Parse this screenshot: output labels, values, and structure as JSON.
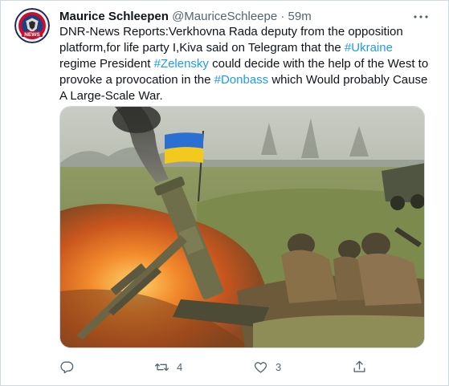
{
  "author": {
    "name": "Maurice Schleepen",
    "handle": "@MauriceSchleepe",
    "separator": "·",
    "time": "59m",
    "avatar_text": "NEWS"
  },
  "tweet": {
    "segments": [
      {
        "text": "DNR-News Reports:Verkhovna Rada deputy from the opposition platform,for life party I,Kiva said on Telegram that the ",
        "type": "text"
      },
      {
        "text": "#Ukraine",
        "type": "hashtag"
      },
      {
        "text": " regime President ",
        "type": "text"
      },
      {
        "text": "#Zelensky",
        "type": "hashtag"
      },
      {
        "text": " could decide with the help of the West to provoke a provocation in the ",
        "type": "text"
      },
      {
        "text": "#Donbass",
        "type": "hashtag"
      },
      {
        "text": " which Would probably Cause A Large-Scale War.",
        "type": "text"
      }
    ]
  },
  "media": {
    "description_icon": "photo-soldiers-mortar"
  },
  "actions": {
    "reply": {
      "icon": "reply-icon",
      "count": ""
    },
    "retweet": {
      "icon": "retweet-icon",
      "count": "4"
    },
    "like": {
      "icon": "heart-icon",
      "count": "3"
    },
    "share": {
      "icon": "share-icon",
      "count": ""
    }
  },
  "colors": {
    "link": "#1d9bf0",
    "secondary": "#536471",
    "text": "#0f1419",
    "border": "#cfd9de"
  }
}
